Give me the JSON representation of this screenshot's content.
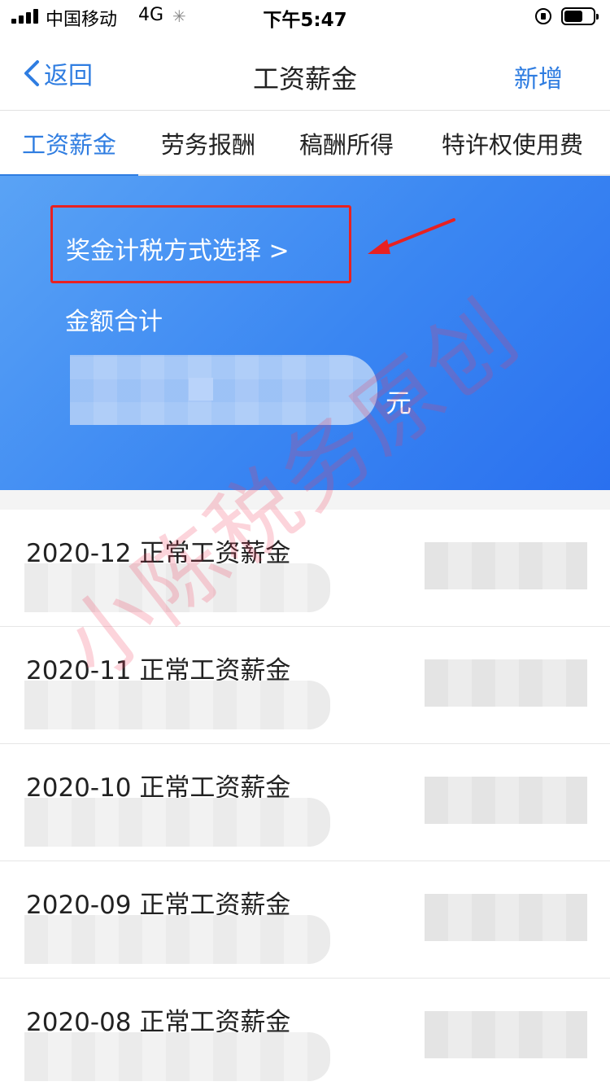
{
  "status_bar": {
    "carrier": "中国移动",
    "network": "4G",
    "time": "下午5:47"
  },
  "nav": {
    "back_label": "返回",
    "title": "工资薪金",
    "add_label": "新增"
  },
  "tabs": [
    {
      "label": "工资薪金",
      "active": true
    },
    {
      "label": "劳务报酬",
      "active": false
    },
    {
      "label": "稿酬所得",
      "active": false
    },
    {
      "label": "特许权使用费",
      "active": false
    }
  ],
  "summary": {
    "bonus_method_link": "奖金计税方式选择 >",
    "total_label": "金额合计",
    "unit": "元"
  },
  "records": [
    {
      "title": "2020-12 正常工资薪金"
    },
    {
      "title": "2020-11 正常工资薪金"
    },
    {
      "title": "2020-10 正常工资薪金"
    },
    {
      "title": "2020-09 正常工资薪金"
    },
    {
      "title": "2020-08 正常工资薪金"
    }
  ],
  "watermark": "小陈税务原创",
  "colors": {
    "accent": "#2f7de1",
    "panel": "#3a86f2",
    "highlight_box": "#e82121"
  }
}
